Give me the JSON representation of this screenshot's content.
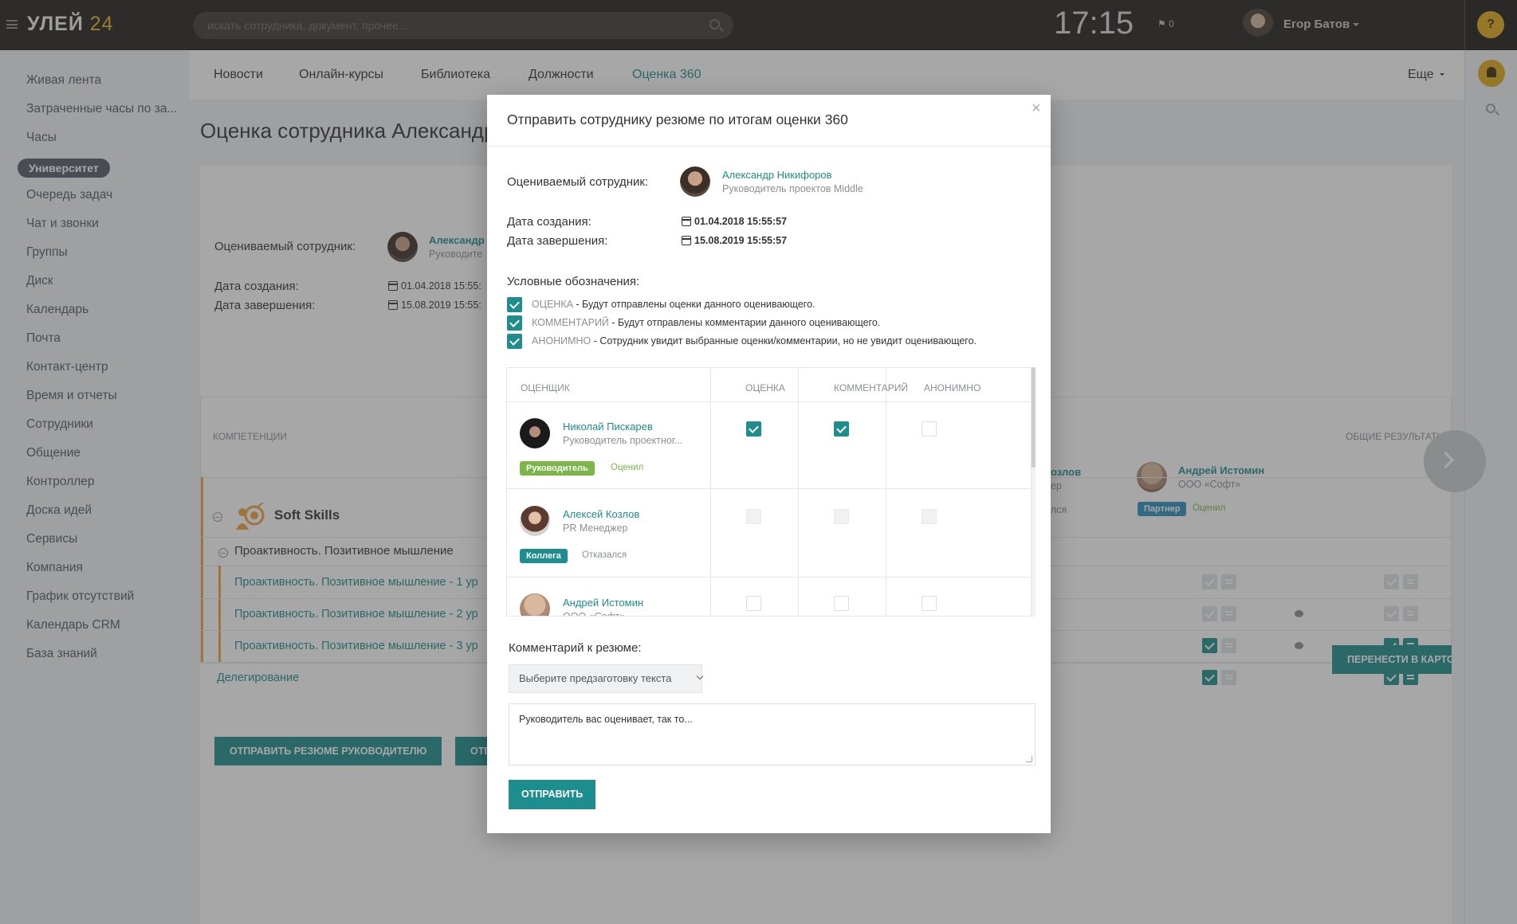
{
  "app": {
    "logo_main": "УЛЕЙ",
    "logo_num": "24",
    "search_placeholder": "искать сотрудника, документ, прочее...",
    "clock": "17:15",
    "flag_count": "0",
    "user_name": "Егор Батов",
    "help": "?"
  },
  "nav": {
    "items": [
      "Живая лента",
      "Затраченные часы по за...",
      "Часы",
      "Очередь задач",
      "Чат и звонки",
      "Группы",
      "Диск",
      "Календарь",
      "Почта",
      "Контакт-центр",
      "Время и отчеты",
      "Сотрудники",
      "Общение",
      "Контроллер",
      "Доска идей",
      "Сервисы",
      "Компания",
      "График отсутствий",
      "Календарь CRM",
      "База знаний"
    ],
    "active": "Университет"
  },
  "tabs": [
    "Новости",
    "Онлайн-курсы",
    "Библиотека",
    "Должности",
    "Оценка 360"
  ],
  "more": "Еще",
  "page": {
    "title": "Оценка сотрудника Александр",
    "evaluated_label": "Оцениваемый сотрудник:",
    "evaluated_name": "Александр",
    "evaluated_role": "Руководите",
    "created_label": "Дата создания:",
    "created_value": "01.04.2018 15:55:",
    "finished_label": "Дата завершения:",
    "finished_value": "15.08.2019 15:55:",
    "col_competencies": "КОМПЕТЕНЦИИ",
    "col_overall": "ОБЩИЕ РЕЗУЛЬТАТЫ",
    "group": "Soft Skills",
    "competency": "Проактивность. Позитивное мышление",
    "sub_items": [
      "Проактивность. Позитивное мышление - 1 ур",
      "Проактивность. Позитивное мышление - 2 ур",
      "Проактивность. Позитивное мышление - 3 ур"
    ],
    "delegation": "Делегирование",
    "evaluator_partial_name": "озлов",
    "evaluator_partial_role": "ер",
    "evaluator_partial_status": "лся",
    "evaluator2_name": "Андрей Истомин",
    "evaluator2_org": "ООО «Софт»",
    "evaluator2_badge": "Партнер",
    "evaluator2_status": "Оценил",
    "transfer_button": "ПЕРЕНЕСТИ В КАРТОЧК",
    "send_to_manager_button": "ОТПРАВИТЬ РЕЗЮМЕ РУКОВОДИТЕЛЮ",
    "send_other_button": "ОТП"
  },
  "modal": {
    "title": "Отправить сотруднику резюме по итогам оценки 360",
    "evaluated_label": "Оцениваемый сотрудник:",
    "evaluated_name": "Александр Никифоров",
    "evaluated_role": "Руководитель проектов Middle",
    "created_label": "Дата создания:",
    "created_value": "01.04.2018 15:55:57",
    "finished_label": "Дата завершения:",
    "finished_value": "15.08.2019 15:55:57",
    "legend_title": "Условные обозначения:",
    "legend": [
      {
        "key": "ОЦЕНКА",
        "text": " - Будут отправлены оценки данного оценивающего."
      },
      {
        "key": "КОММЕНТАРИЙ",
        "text": " - Будут отправлены комментарии данного оценивающего."
      },
      {
        "key": "АНОНИМНО",
        "text": " - Сотрудник увидит выбранные оценки/комментарии, но не увидит оценивающего."
      }
    ],
    "columns": [
      "ОЦЕНЩИК",
      "ОЦЕНКА",
      "КОММЕНТАРИЙ",
      "АНОНИМНО"
    ],
    "rows": [
      {
        "name": "Николай Пискарев",
        "role": "Руководитель проектног...",
        "badge": "Руководитель",
        "badge_color": "#7ab648",
        "status": "Оценил",
        "status_color": "#7ab648",
        "rating": true,
        "comment": true,
        "anonymous": false,
        "disabled": false
      },
      {
        "name": "Алексей Козлов",
        "role": "PR Менеджер",
        "badge": "Коллега",
        "badge_color": "#1e8d8d",
        "status": "Отказался",
        "status_color": "#8a8f95",
        "rating": false,
        "comment": false,
        "anonymous": false,
        "disabled": true
      },
      {
        "name": "Андрей Истомин",
        "role": "ООО «Софт»",
        "rating": false,
        "comment": false,
        "anonymous": false,
        "disabled": false
      }
    ],
    "comment_label": "Комментарий к резюме:",
    "preset_placeholder": "Выберите предзаготовку текста",
    "comment_value": "Руководитель вас оценивает, так то...",
    "send_button": "ОТПРАВИТЬ",
    "close": "×"
  },
  "colors": {
    "accent": "#1e8d8d",
    "topbar": "#211f1d",
    "gold": "#e2b331",
    "orange": "#f0a040",
    "green": "#7ab648"
  }
}
